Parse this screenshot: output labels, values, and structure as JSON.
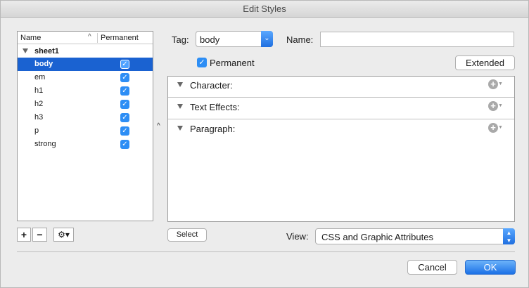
{
  "window": {
    "title": "Edit Styles"
  },
  "list": {
    "header_name": "Name",
    "header_permanent": "Permanent",
    "group": "sheet1",
    "items": [
      {
        "label": "body",
        "permanent": true,
        "selected": true
      },
      {
        "label": "em",
        "permanent": true,
        "selected": false
      },
      {
        "label": "h1",
        "permanent": true,
        "selected": false
      },
      {
        "label": "h2",
        "permanent": true,
        "selected": false
      },
      {
        "label": "h3",
        "permanent": true,
        "selected": false
      },
      {
        "label": "p",
        "permanent": true,
        "selected": false
      },
      {
        "label": "strong",
        "permanent": true,
        "selected": false
      }
    ],
    "add_label": "+",
    "remove_label": "−",
    "gear_label": "⚙▾"
  },
  "form": {
    "tag_label": "Tag:",
    "tag_value": "body",
    "name_label": "Name:",
    "name_value": "",
    "permanent_label": "Permanent",
    "extended_label": "Extended"
  },
  "sections": [
    {
      "title": "Character:"
    },
    {
      "title": "Text Effects:"
    },
    {
      "title": "Paragraph:"
    }
  ],
  "footer": {
    "select_label": "Select",
    "view_label": "View:",
    "view_value": "CSS and Graphic Attributes",
    "cancel_label": "Cancel",
    "ok_label": "OK"
  },
  "colors": {
    "accent": "#1a62d1",
    "checkbox": "#2d8ef5"
  }
}
